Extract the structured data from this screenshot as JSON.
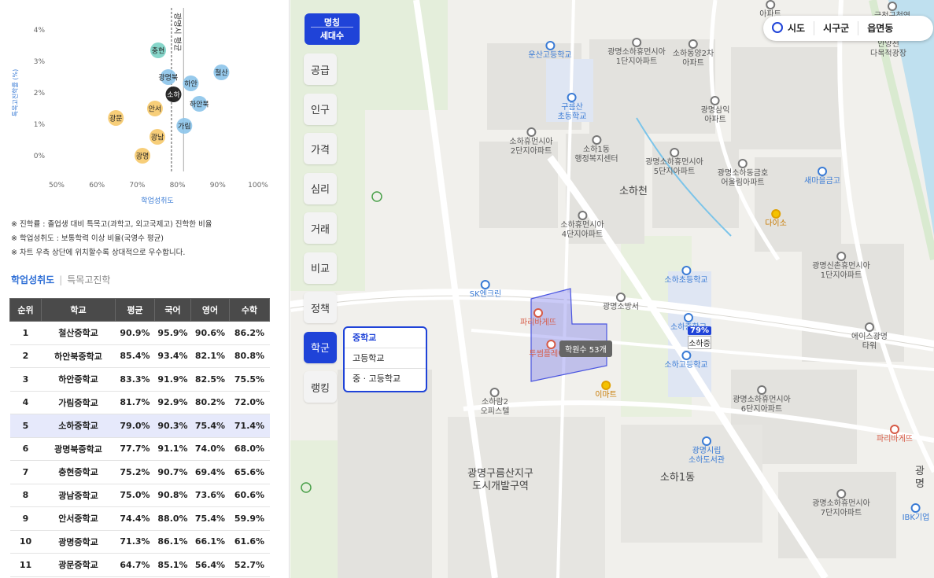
{
  "chart_data": {
    "type": "scatter",
    "xlabel": "학업성취도",
    "ylabel": "특목고진학률 (%)",
    "xlim": [
      50,
      100
    ],
    "ylim": [
      -0.5,
      4.4
    ],
    "xticks": [
      "50%",
      "60%",
      "70%",
      "80%",
      "90%",
      "100%"
    ],
    "xtick_values": [
      50,
      60,
      70,
      80,
      90,
      100
    ],
    "yticks": [
      "0%",
      "1%",
      "2%",
      "3%",
      "4%"
    ],
    "ytick_values": [
      0,
      1,
      2,
      3,
      4
    ],
    "ref_x_dashed": 78.5,
    "ref_x_solid": 81.5,
    "ref_line_label": "광명시 평균",
    "points": [
      {
        "label": "철산",
        "x": 90.9,
        "y": 2.65,
        "color": "#8cc4ea"
      },
      {
        "label": "하안북",
        "x": 85.4,
        "y": 1.65,
        "color": "#8cc4ea"
      },
      {
        "label": "하안",
        "x": 83.3,
        "y": 2.3,
        "color": "#8cc4ea"
      },
      {
        "label": "가림",
        "x": 81.7,
        "y": 0.95,
        "color": "#8cc4ea"
      },
      {
        "label": "소하",
        "x": 79.0,
        "y": 1.95,
        "color": "#111111"
      },
      {
        "label": "광명북",
        "x": 77.7,
        "y": 2.5,
        "color": "#8cc4ea"
      },
      {
        "label": "충현",
        "x": 75.2,
        "y": 3.35,
        "color": "#7ad1c4"
      },
      {
        "label": "광남",
        "x": 75.0,
        "y": 0.6,
        "color": "#f6c96a"
      },
      {
        "label": "안서",
        "x": 74.4,
        "y": 1.5,
        "color": "#f6c96a"
      },
      {
        "label": "광명",
        "x": 71.3,
        "y": 0.0,
        "color": "#f6c96a"
      },
      {
        "label": "광문",
        "x": 64.7,
        "y": 1.2,
        "color": "#f6c96a"
      }
    ]
  },
  "notes": [
    "※ 진학률 : 졸업생 대비 특목고(과학고, 외고국제고) 진학한 비율",
    "※ 학업성취도 : 보통학력 이상 비율(국영수 평균)",
    "※ 차트 우측 상단에 위치할수록 상대적으로 우수합니다."
  ],
  "subtabs": {
    "active": "학업성취도",
    "other": "특목고진학"
  },
  "table": {
    "headers": [
      "순위",
      "학교",
      "평균",
      "국어",
      "영어",
      "수학"
    ],
    "rows": [
      [
        "1",
        "철산중학교",
        "90.9%",
        "95.9%",
        "90.6%",
        "86.2%"
      ],
      [
        "2",
        "하안북중학교",
        "85.4%",
        "93.4%",
        "82.1%",
        "80.8%"
      ],
      [
        "3",
        "하안중학교",
        "83.3%",
        "91.9%",
        "82.5%",
        "75.5%"
      ],
      [
        "4",
        "가림중학교",
        "81.7%",
        "92.9%",
        "80.2%",
        "72.0%"
      ],
      [
        "5",
        "소하중학교",
        "79.0%",
        "90.3%",
        "75.4%",
        "71.4%"
      ],
      [
        "6",
        "광명북중학교",
        "77.7%",
        "91.1%",
        "74.0%",
        "68.0%"
      ],
      [
        "7",
        "충현중학교",
        "75.2%",
        "90.7%",
        "69.4%",
        "65.6%"
      ],
      [
        "8",
        "광남중학교",
        "75.0%",
        "90.8%",
        "73.6%",
        "60.6%"
      ],
      [
        "9",
        "안서중학교",
        "74.4%",
        "88.0%",
        "75.4%",
        "59.9%"
      ],
      [
        "10",
        "광명중학교",
        "71.3%",
        "86.1%",
        "66.1%",
        "61.6%"
      ],
      [
        "11",
        "광문중학교",
        "64.7%",
        "85.1%",
        "56.4%",
        "52.7%"
      ]
    ],
    "highlight_row": 4
  },
  "map": {
    "menu_head": {
      "line1": "명칭",
      "line2": "세대수"
    },
    "menu": [
      "공급",
      "인구",
      "가격",
      "심리",
      "거래",
      "비교",
      "정책",
      "학군",
      "랭킹"
    ],
    "active_menu": "학군",
    "submenu": [
      "중학교",
      "고등학교",
      "중 · 고등학교"
    ],
    "submenu_selected": "중학교",
    "region_bar": [
      "시도",
      "시구군",
      "읍면동"
    ],
    "badge": {
      "value": "79%",
      "name": "소하중"
    },
    "academy_tooltip": "학원수 53개",
    "pois": [
      {
        "t": "운산고등학교",
        "c": "blue"
      },
      {
        "t": "광명소하휴먼시아\n1단지아파트",
        "c": ""
      },
      {
        "t": "소하동양2차\n아파트",
        "c": ""
      },
      {
        "t": "구름산\n초등학교",
        "c": "blue"
      },
      {
        "t": "광명삼익\n아파트",
        "c": ""
      },
      {
        "t": "소하휴먼시아\n2단지아파트",
        "c": ""
      },
      {
        "t": "소하1동\n행정복지센터",
        "c": ""
      },
      {
        "t": "광명소하휴먼시아\n5단지아파트",
        "c": ""
      },
      {
        "t": "광명소하동금호\n어울림아파트",
        "c": ""
      },
      {
        "t": "새마을금고",
        "c": "blue"
      },
      {
        "t": "소하휴먼시아\n4단지아파트",
        "c": ""
      },
      {
        "t": "다이소",
        "c": "orange"
      },
      {
        "t": "광명신촌휴먼시아\n1단지아파트",
        "c": ""
      },
      {
        "t": "SK엔크린",
        "c": "blue"
      },
      {
        "t": "광명소방서",
        "c": ""
      },
      {
        "t": "소하초등학교",
        "c": "blue"
      },
      {
        "t": "파리바게뜨",
        "c": "red"
      },
      {
        "t": "소하중학교",
        "c": "blue"
      },
      {
        "t": "에이스광명\n타워",
        "c": ""
      },
      {
        "t": "투썸플레이스",
        "c": "red"
      },
      {
        "t": "소하고등학교",
        "c": "blue"
      },
      {
        "t": "이마트",
        "c": "orange"
      },
      {
        "t": "광명소하휴먼시아\n6단지아파트",
        "c": ""
      },
      {
        "t": "소하람2\n오피스텔",
        "c": ""
      },
      {
        "t": "광명시립\n소하도서관",
        "c": "blue"
      },
      {
        "t": "파리바게뜨",
        "c": "red"
      },
      {
        "t": "광명소하휴먼시아\n7단지아파트",
        "c": ""
      },
      {
        "t": "IBK기업",
        "c": "blue"
      },
      {
        "t": "안양천\n다목적광장",
        "c": ""
      },
      {
        "t": "금천구청역",
        "c": ""
      },
      {
        "t": "아파트",
        "c": ""
      }
    ],
    "area_labels": [
      "광명구름산지구\n도시개발구역",
      "소하1동",
      "소하천",
      "광명"
    ]
  }
}
